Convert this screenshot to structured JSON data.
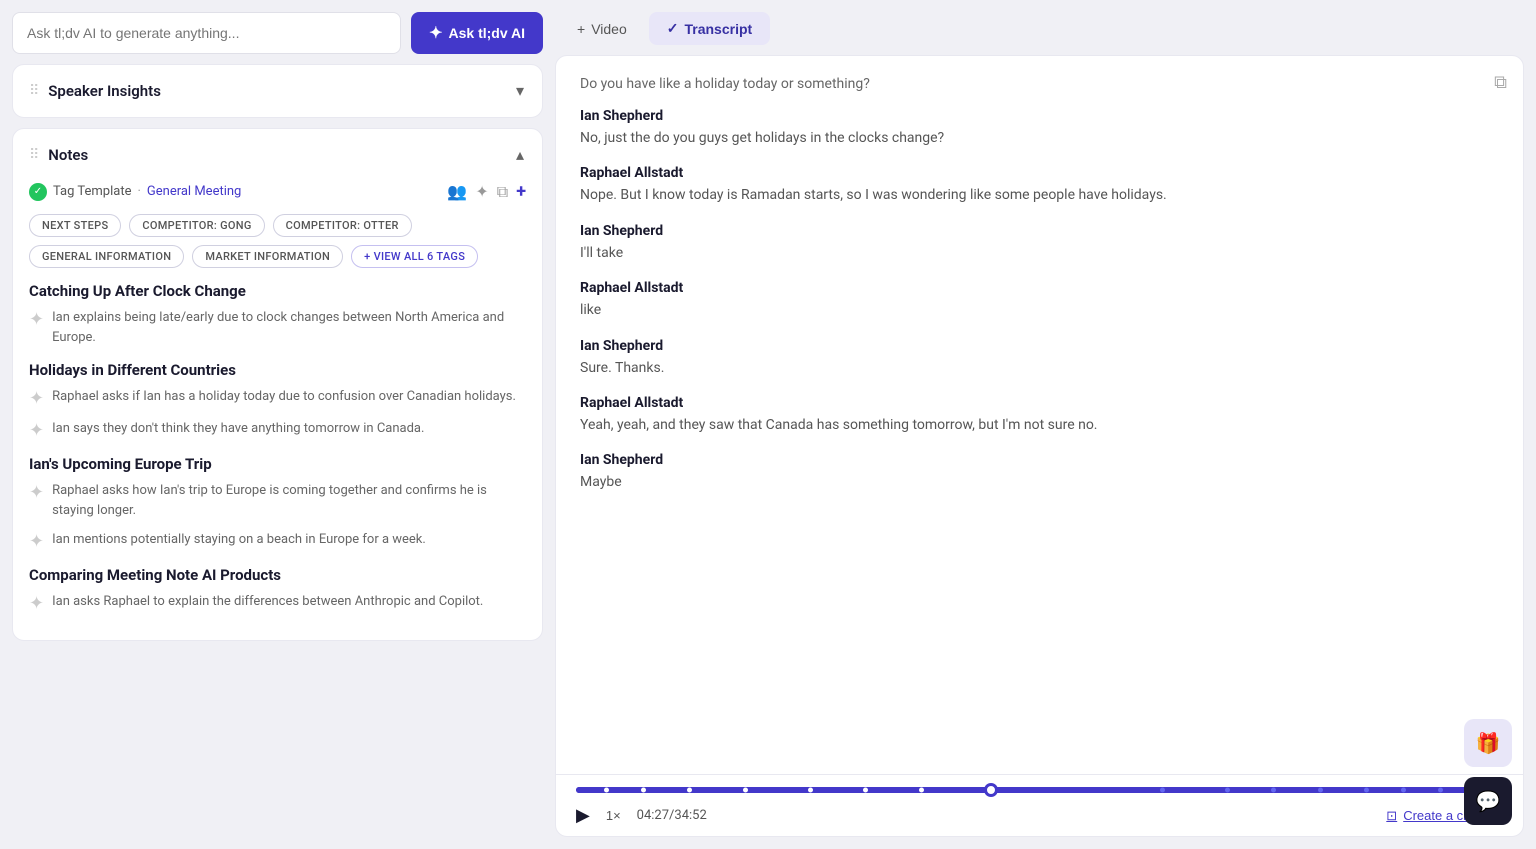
{
  "search": {
    "placeholder": "Ask tl;dv AI to generate anything..."
  },
  "ask_ai_btn": {
    "label": "Ask tl;dv AI",
    "icon": "✦"
  },
  "speaker_insights": {
    "title": "Speaker Insights"
  },
  "notes": {
    "title": "Notes",
    "tag_template_label": "Tag Template",
    "tag_template_link": "General Meeting",
    "tags": [
      {
        "label": "NEXT STEPS"
      },
      {
        "label": "COMPETITOR: GONG"
      },
      {
        "label": "COMPETITOR: OTTER"
      },
      {
        "label": "GENERAL INFORMATION"
      },
      {
        "label": "MARKET INFORMATION"
      },
      {
        "label": "+ VIEW ALL 6 TAGS",
        "type": "view-all"
      }
    ],
    "sections": [
      {
        "title": "Catching Up After Clock Change",
        "items": [
          {
            "text": "Ian explains being late/early due to clock changes between North America and Europe."
          }
        ]
      },
      {
        "title": "Holidays in Different Countries",
        "items": [
          {
            "text": "Raphael asks if Ian has a holiday today due to confusion over Canadian holidays."
          },
          {
            "text": "Ian says they don't think they have anything tomorrow in Canada."
          }
        ]
      },
      {
        "title": "Ian's Upcoming Europe Trip",
        "items": [
          {
            "text": "Raphael asks how Ian's trip to Europe is coming together and confirms he is staying longer."
          },
          {
            "text": "Ian mentions potentially staying on a beach in Europe for a week."
          }
        ]
      },
      {
        "title": "Comparing Meeting Note AI Products",
        "items": [
          {
            "text": "Ian asks Raphael to explain the differences between Anthropic and Copilot."
          }
        ]
      }
    ]
  },
  "tabs": {
    "video": {
      "label": "Video",
      "icon": "+"
    },
    "transcript": {
      "label": "Transcript",
      "icon": "✓"
    }
  },
  "transcript": {
    "copy_icon": "⧉",
    "lines": [
      {
        "type": "question",
        "text": "Do you have like a holiday today or something?"
      },
      {
        "speaker": "Ian Shepherd",
        "text": "No, just the do you guys get holidays in the clocks change?"
      },
      {
        "speaker": "Raphael Allstadt",
        "text": "Nope. But I know today is Ramadan starts, so I was wondering like some people have holidays."
      },
      {
        "speaker": "Ian Shepherd",
        "text": "I'll take"
      },
      {
        "speaker": "Raphael Allstadt",
        "text": "like"
      },
      {
        "speaker": "Ian Shepherd",
        "text": "Sure. Thanks."
      },
      {
        "speaker": "Raphael Allstadt",
        "text": "Yeah, yeah, and they saw that Canada has something tomorrow, but I'm not sure no."
      },
      {
        "speaker": "Ian Shepherd",
        "text": "Maybe"
      }
    ]
  },
  "player": {
    "time_current": "04:27",
    "time_total": "34:52",
    "time_display": "04:27/34:52",
    "speed": "1×",
    "create_clip": "Create a clip",
    "progress_percent": 44
  },
  "floating_btns": {
    "gift": "🎁",
    "chat": "💬"
  }
}
